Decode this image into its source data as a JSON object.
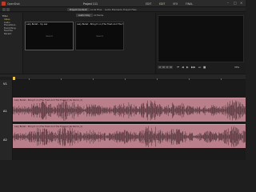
{
  "window": {
    "app_name": "OpenShot",
    "project_title": "Project 111",
    "workspace_tabs": [
      {
        "label": "EDIT",
        "active": false
      },
      {
        "label": "EDIT",
        "active": true
      },
      {
        "label": "VFX",
        "active": false
      },
      {
        "label": "FINAL",
        "active": false
      }
    ],
    "controls": [
      "–",
      "□",
      "×"
    ]
  },
  "media_tabs": [
    {
      "label": "Project Content",
      "active": true
    },
    {
      "label": "Local Files",
      "active": false
    },
    {
      "label": "Audio Elements",
      "active": false
    },
    {
      "label": "Project Files",
      "active": false
    }
  ],
  "sub_tabs": [
    {
      "label": "Audio Only",
      "active": true
    },
    {
      "label": "All Media",
      "active": false
    }
  ],
  "left_panel": {
    "title": "Filter",
    "items": [
      "Video",
      "Audio",
      "Transitions",
      "Everything",
      "Favorite",
      "Recent"
    ],
    "selected_index": 0,
    "effects_label": "FX"
  },
  "clips": [
    {
      "name": "Lazy Bullet - my war",
      "sound_label": "Sound"
    },
    {
      "name": "Lazy Bullet - Bring It on (The Trash And The Trappi",
      "sound_label": "Sound"
    }
  ],
  "viewer": {
    "timecode": "00:00:00:00",
    "zoom": "33%",
    "controls": [
      "⏮",
      "◀",
      "▶",
      "▶▶",
      "⏭",
      "■"
    ]
  },
  "tracks": [
    {
      "label": "V1"
    },
    {
      "label": "A1"
    },
    {
      "label": "A2"
    }
  ],
  "audio_clip": {
    "label": "Lazy Bullet - Bring It on (The Trash And The Trapped_Ra Remix_2)",
    "color": "#b9808b"
  }
}
